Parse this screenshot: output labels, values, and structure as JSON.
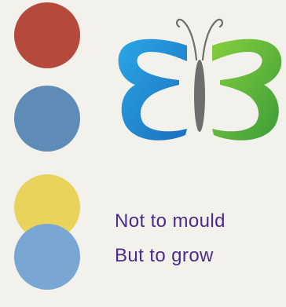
{
  "colors": {
    "background": "#f2f1ec",
    "dot_red": "#b5493c",
    "dot_blue": "#5f8bb7",
    "dot_yellow": "#ead35c",
    "dot_light_blue": "#79a6d2",
    "logo_blue": "#1b86c9",
    "logo_green": "#5ab53a",
    "logo_body": "#6e6e6e",
    "text_purple": "#4b2b8c"
  },
  "icons": {
    "logo": "butterfly-logo-icon",
    "dots": [
      "circle-red",
      "circle-blue",
      "circle-yellow",
      "circle-light-blue"
    ]
  },
  "tagline": {
    "line1": "Not to mould",
    "line2": "But to grow"
  }
}
